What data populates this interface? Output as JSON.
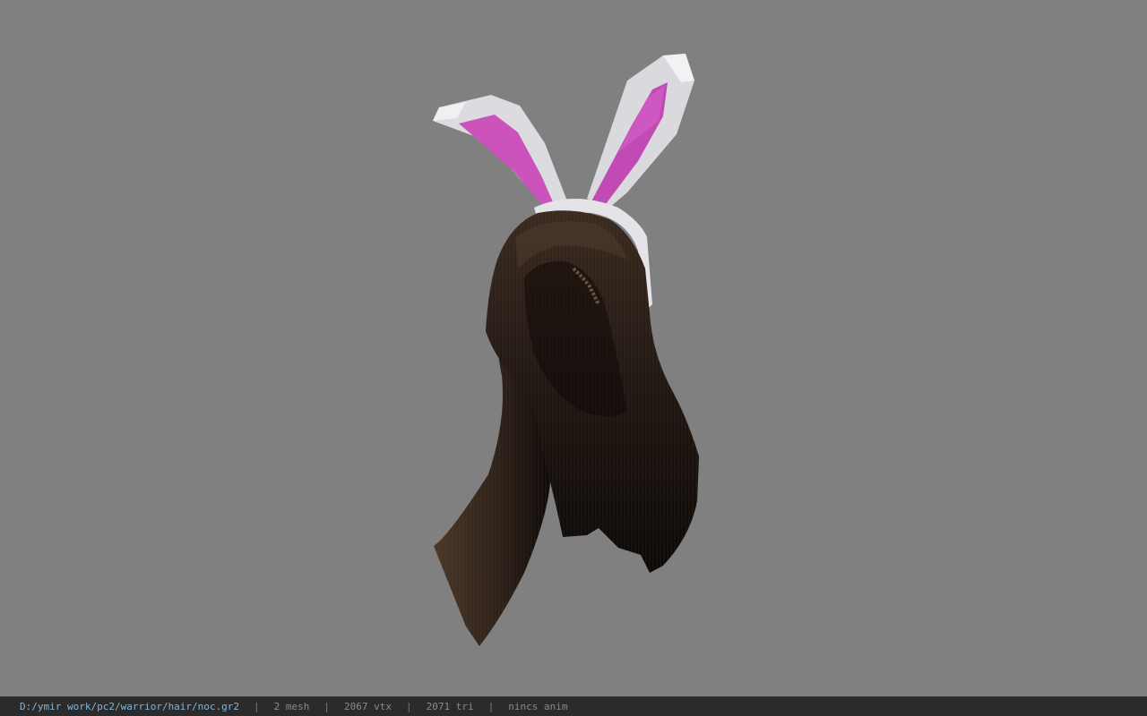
{
  "viewer": {
    "background_color": "#808080",
    "model_icon": "hair-with-bunny-ears-model"
  },
  "status": {
    "file_path": "D:/ymir work/pc2/warrior/hair/noc.gr2",
    "separator": "|",
    "mesh": "2 mesh",
    "vertices": "2067 vtx",
    "triangles": "2071 tri",
    "animation": "nincs anim"
  }
}
